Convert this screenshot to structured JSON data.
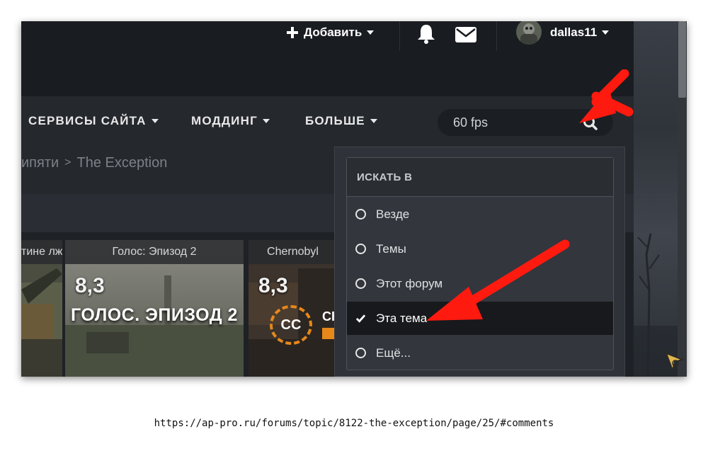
{
  "topbar": {
    "add_label": "Добавить",
    "username": "dallas11"
  },
  "nav": {
    "items": [
      {
        "label": "СЕРВИСЫ САЙТА"
      },
      {
        "label": "МОДДИНГ"
      },
      {
        "label": "БОЛЬШЕ"
      }
    ]
  },
  "search": {
    "value": "60 fps"
  },
  "breadcrumb": {
    "items": [
      "ипяти",
      "The Exception"
    ],
    "separator": ">"
  },
  "cards": [
    {
      "title": "тине лж",
      "rating": ""
    },
    {
      "title": "Голос: Эпизод 2",
      "rating": "8,3",
      "banner": "ГОЛОС. ЭПИЗОД 2"
    },
    {
      "title": "Chernobyl",
      "rating": "8,3",
      "logo": "СС",
      "logo_side": "СН"
    }
  ],
  "search_dropdown": {
    "header": "ИСКАТЬ В",
    "options": [
      {
        "label": "Везде",
        "selected": false
      },
      {
        "label": "Темы",
        "selected": false
      },
      {
        "label": "Этот форум",
        "selected": false
      },
      {
        "label": "Эта тема",
        "selected": true
      },
      {
        "label": "Ещё...",
        "selected": false
      }
    ]
  },
  "footer": {
    "url": "https://ap-pro.ru/forums/topic/8122-the-exception/page/25/#comments"
  },
  "colors": {
    "annotation_arrow": "#ff1a10",
    "topbar_bg": "#191c21",
    "nav_bg": "#25282d",
    "dropdown_bg": "#2f3238",
    "selected_row_bg": "#17191c"
  }
}
